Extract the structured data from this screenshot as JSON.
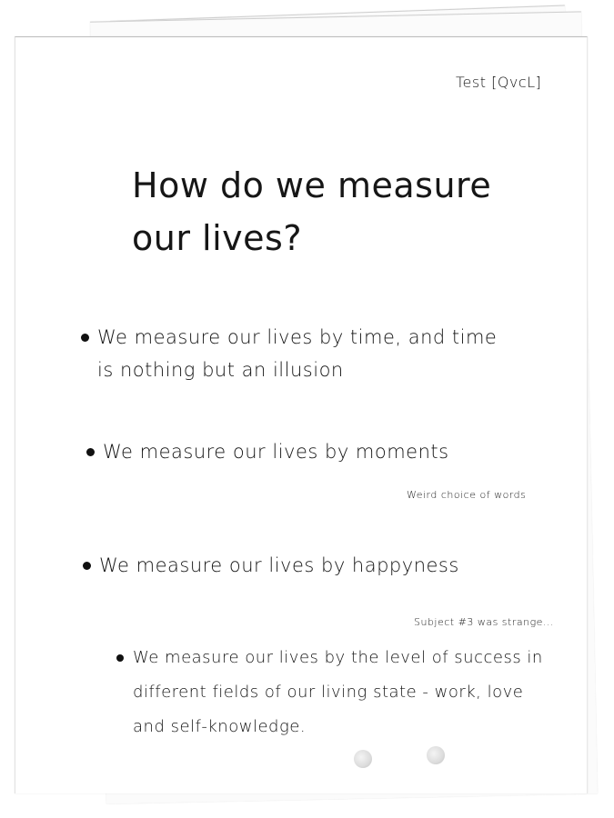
{
  "document": {
    "label": "Test [QvcL]",
    "title": "How do we measure our lives?",
    "bullets": [
      "We measure our lives by time, and time is nothing but an illusion",
      "We measure our lives by moments",
      "We measure our lives by happyness",
      "We measure our lives by the level of success in different fields of our living state - work, love and self-knowledge."
    ],
    "notes": [
      "Weird choice of words",
      "Subject #3 was strange..."
    ]
  }
}
